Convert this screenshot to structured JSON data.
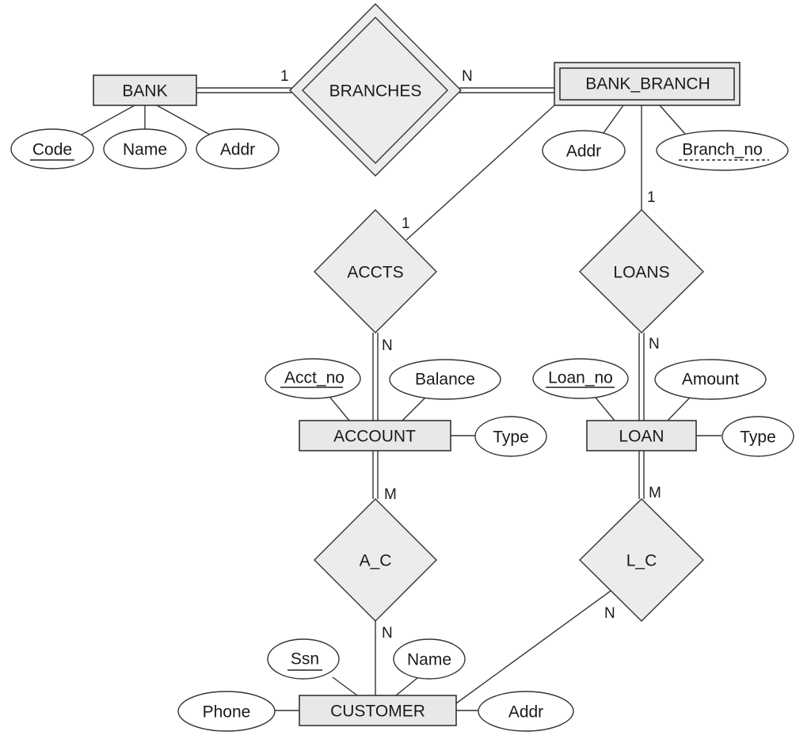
{
  "diagram": {
    "type": "ER diagram",
    "entities": [
      {
        "id": "bank",
        "label": "BANK",
        "weak": false
      },
      {
        "id": "bank_branch",
        "label": "BANK_BRANCH",
        "weak": true
      },
      {
        "id": "account",
        "label": "ACCOUNT",
        "weak": false
      },
      {
        "id": "loan",
        "label": "LOAN",
        "weak": false
      },
      {
        "id": "customer",
        "label": "CUSTOMER",
        "weak": false
      }
    ],
    "relationships": [
      {
        "id": "branches",
        "label": "BRANCHES",
        "identifying": true
      },
      {
        "id": "accts",
        "label": "ACCTS",
        "identifying": false
      },
      {
        "id": "loans",
        "label": "LOANS",
        "identifying": false
      },
      {
        "id": "a_c",
        "label": "A_C",
        "identifying": false
      },
      {
        "id": "l_c",
        "label": "L_C",
        "identifying": false
      }
    ],
    "attributes": {
      "bank": [
        {
          "label": "Code",
          "key": "primary"
        },
        {
          "label": "Name",
          "key": "none"
        },
        {
          "label": "Addr",
          "key": "none"
        }
      ],
      "bank_branch": [
        {
          "label": "Addr",
          "key": "none"
        },
        {
          "label": "Branch_no",
          "key": "partial"
        }
      ],
      "account": [
        {
          "label": "Acct_no",
          "key": "primary"
        },
        {
          "label": "Balance",
          "key": "none"
        },
        {
          "label": "Type",
          "key": "none"
        }
      ],
      "loan": [
        {
          "label": "Loan_no",
          "key": "primary"
        },
        {
          "label": "Amount",
          "key": "none"
        },
        {
          "label": "Type",
          "key": "none"
        }
      ],
      "customer": [
        {
          "label": "Ssn",
          "key": "primary"
        },
        {
          "label": "Name",
          "key": "none"
        },
        {
          "label": "Phone",
          "key": "none"
        },
        {
          "label": "Addr",
          "key": "none"
        }
      ]
    },
    "cardinalities": {
      "bank_branches": "1",
      "branches_bank_branch": "N",
      "bank_branch_accts": "1",
      "accts_account": "N",
      "bank_branch_loans": "1",
      "loans_loan": "N",
      "account_a_c": "M",
      "a_c_customer": "N",
      "loan_l_c": "M",
      "l_c_customer": "N"
    },
    "participation": {
      "bank_branches": "total",
      "bank_branch_branches": "total",
      "accts_account": "total",
      "loans_loan": "total",
      "account_a_c": "total",
      "loan_l_c": "total",
      "bank_branch_accts": "partial",
      "bank_branch_loans": "partial",
      "a_c_customer": "partial",
      "l_c_customer": "partial"
    },
    "colors": {
      "entity_fill": "#e8e8e8",
      "relationship_fill": "#ececec",
      "attribute_fill": "#ffffff",
      "stroke": "#333333"
    }
  }
}
